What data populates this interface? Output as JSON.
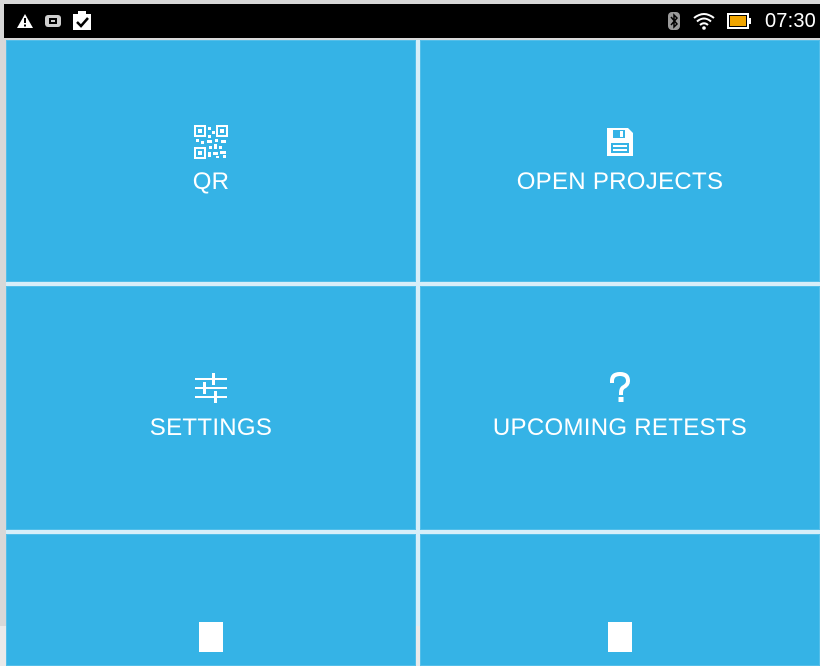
{
  "status_bar": {
    "time": "07:30",
    "left_icons": [
      "warning-icon",
      "message-icon",
      "checkbox-icon"
    ],
    "right_icons": [
      "bluetooth-icon",
      "wifi-icon",
      "battery-icon"
    ]
  },
  "tiles": [
    {
      "label": "QR",
      "icon": "qr-code-icon"
    },
    {
      "label": "OPEN PROJECTS",
      "icon": "floppy-disk-icon"
    },
    {
      "label": "SETTINGS",
      "icon": "sliders-icon"
    },
    {
      "label": "UPCOMING RETESTS",
      "icon": "question-mark-icon"
    },
    {
      "label": "",
      "icon": ""
    },
    {
      "label": "",
      "icon": ""
    }
  ],
  "colors": {
    "tile_background": "#35b3e6",
    "status_bar": "#000000",
    "text": "#ffffff"
  }
}
